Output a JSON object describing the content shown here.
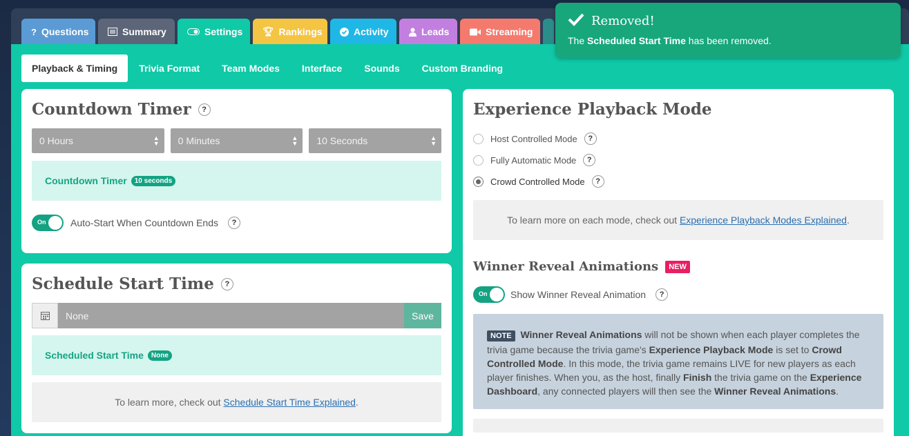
{
  "tabs": [
    {
      "label": "Questions",
      "icon": "question-icon",
      "color": "#5b9bd5"
    },
    {
      "label": "Summary",
      "icon": "list-icon",
      "color": "#5c6678"
    },
    {
      "label": "Settings",
      "icon": "toggle-icon",
      "color": "#10c9a7"
    },
    {
      "label": "Rankings",
      "icon": "trophy-icon",
      "color": "#f4c443"
    },
    {
      "label": "Activity",
      "icon": "check-circle-icon",
      "color": "#1fb7e6"
    },
    {
      "label": "Leads",
      "icon": "user-icon",
      "color": "#c37fe0"
    },
    {
      "label": "Streaming",
      "icon": "video-icon",
      "color": "#f47a6e"
    }
  ],
  "subtabs": [
    "Playback & Timing",
    "Trivia Format",
    "Team Modes",
    "Interface",
    "Sounds",
    "Custom Branding"
  ],
  "countdown": {
    "title": "Countdown Timer",
    "hours": "0 Hours",
    "minutes": "0 Minutes",
    "seconds": "10 Seconds",
    "status_label": "Countdown Timer",
    "status_value": "10 seconds",
    "toggle_on": "On",
    "auto_start_label": "Auto-Start When Countdown Ends"
  },
  "schedule": {
    "title": "Schedule Start Time",
    "input_value": "None",
    "save_label": "Save",
    "status_label": "Scheduled Start Time",
    "status_value": "None",
    "info_prefix": "To learn more, check out ",
    "info_link": "Schedule Start Time Explained",
    "info_suffix": "."
  },
  "playback": {
    "title": "Experience Playback Mode",
    "modes": [
      "Host Controlled Mode",
      "Fully Automatic Mode",
      "Crowd Controlled Mode"
    ],
    "selected_index": 2,
    "info_prefix": "To learn more on each mode, check out ",
    "info_link": "Experience Playback Modes Explained",
    "info_suffix": "."
  },
  "winner": {
    "title": "Winner Reveal Animations",
    "new_badge": "NEW",
    "toggle_on": "On",
    "toggle_label": "Show Winner Reveal Animation",
    "note_badge": "NOTE",
    "note_parts": {
      "a": "Winner Reveal Animations",
      "b": " will not be shown when each player completes the trivia game because the trivia game's ",
      "c": "Experience Playback Mode",
      "d": " is set to ",
      "e": "Crowd Controlled Mode",
      "f": ". In this mode, the trivia game remains LIVE for new players as each player finishes. When you, as the host, finally ",
      "g": "Finish",
      "h": " the trivia game on the ",
      "i": "Experience Dashboard",
      "j": ", any connected players will then see the ",
      "k": "Winner Reveal Animations",
      "l": "."
    }
  },
  "toast": {
    "title": "Removed!",
    "msg_prefix": "The ",
    "msg_bold": "Scheduled Start Time",
    "msg_suffix": " has been removed."
  }
}
